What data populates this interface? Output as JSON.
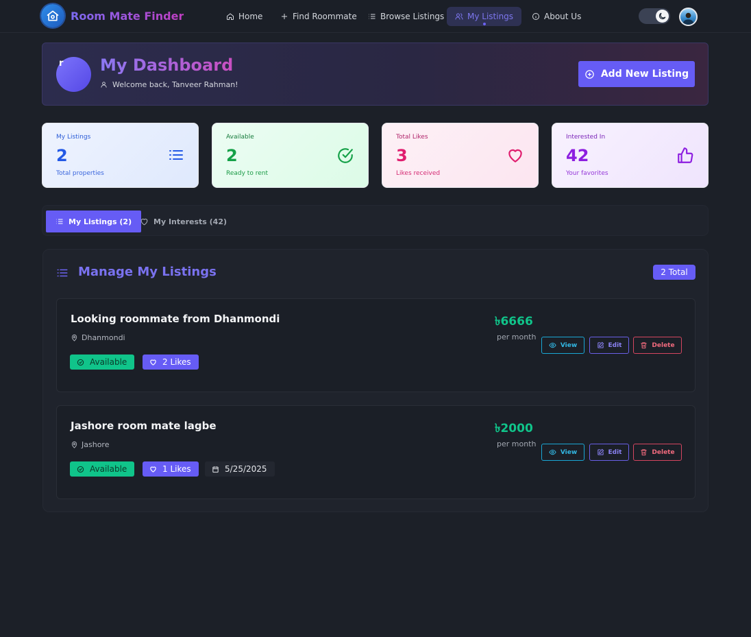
{
  "nav": {
    "brand": "Room Mate Finder",
    "links": [
      {
        "label": "Home",
        "icon": "home-icon"
      },
      {
        "label": "Find Roommate",
        "icon": "plus-icon"
      },
      {
        "label": "Browse Listings",
        "icon": "list-icon"
      },
      {
        "label": "My Listings",
        "icon": "users-icon",
        "active": true
      },
      {
        "label": "About Us",
        "icon": "info-icon"
      }
    ],
    "theme": "dark"
  },
  "hero": {
    "avatar_glyph": "r",
    "title": "My Dashboard",
    "welcome": "Welcome back, Tanveer Rahman!",
    "add_button": "Add New Listing"
  },
  "stats": [
    {
      "label": "My Listings",
      "value": "2",
      "sub": "Total properties",
      "icon": "list-icon",
      "color": "#2359e6"
    },
    {
      "label": "Available",
      "value": "2",
      "sub": "Ready to rent",
      "icon": "check-circle-icon",
      "color": "#15a148"
    },
    {
      "label": "Total Likes",
      "value": "3",
      "sub": "Likes received",
      "icon": "heart-icon",
      "color": "#e01d6e"
    },
    {
      "label": "Interested In",
      "value": "42",
      "sub": "Your favorites",
      "icon": "thumbs-up-icon",
      "color": "#8d1ee0"
    }
  ],
  "tabs": [
    {
      "label": "My Listings (2)",
      "active": true
    },
    {
      "label": "My Interests (42)",
      "active": false
    }
  ],
  "manage": {
    "title": "Manage My Listings",
    "total_badge": "2 Total"
  },
  "listings": [
    {
      "title": "Looking roommate from Dhanmondi",
      "location": "Dhanmondi",
      "status": "Available",
      "likes": "2 Likes",
      "price": "৳6666",
      "per": "per month",
      "actions": {
        "view": "View",
        "edit": "Edit",
        "delete": "Delete"
      }
    },
    {
      "title": "Jashore room mate lagbe",
      "location": "Jashore",
      "status": "Available",
      "likes": "1 Likes",
      "date": "5/25/2025",
      "price": "৳2000",
      "per": "per month",
      "actions": {
        "view": "View",
        "edit": "Edit",
        "delete": "Delete"
      }
    }
  ],
  "colors": {
    "accent": "#665cf5",
    "success": "#10c48a",
    "danger": "#d64660",
    "info": "#1aa8d6",
    "background": "#1c2028"
  }
}
